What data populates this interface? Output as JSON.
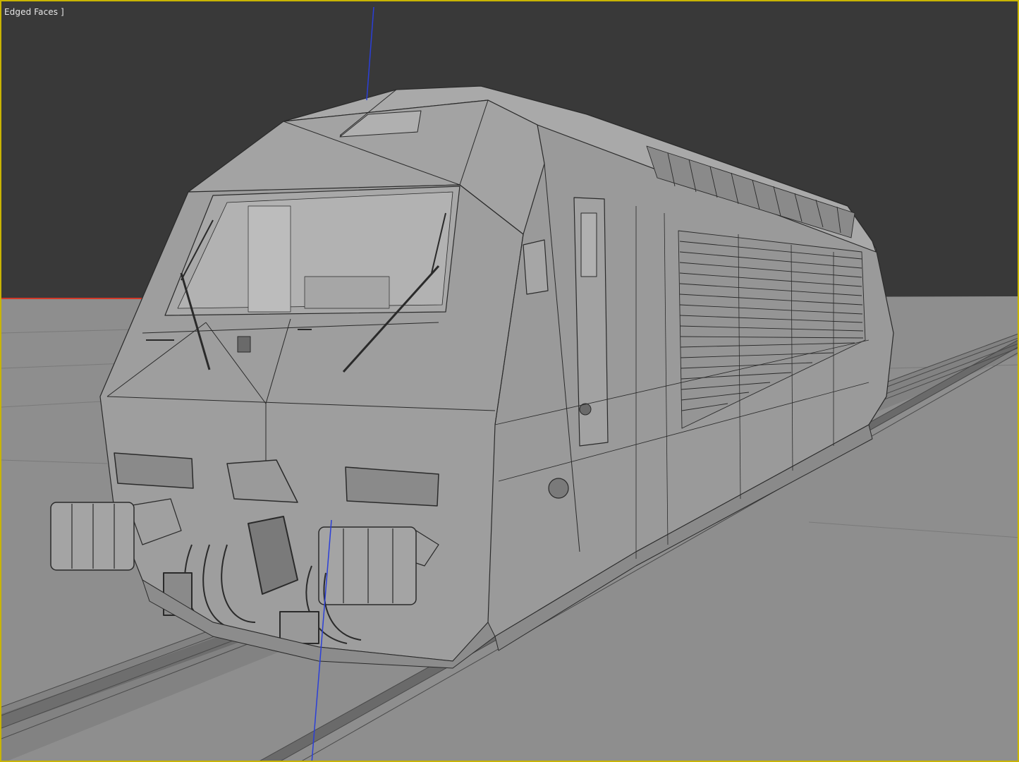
{
  "viewport": {
    "label": "Edged Faces ]",
    "border_color": "#c8b400",
    "background_color": "#393939",
    "ground_color": "#8e8e8e",
    "model_color": "#9a9a9a",
    "wire_color": "#2a2a2a",
    "axes": {
      "x_color": "#d03a2a",
      "z_color": "#2b3fd8"
    },
    "model": "electric-locomotive"
  }
}
